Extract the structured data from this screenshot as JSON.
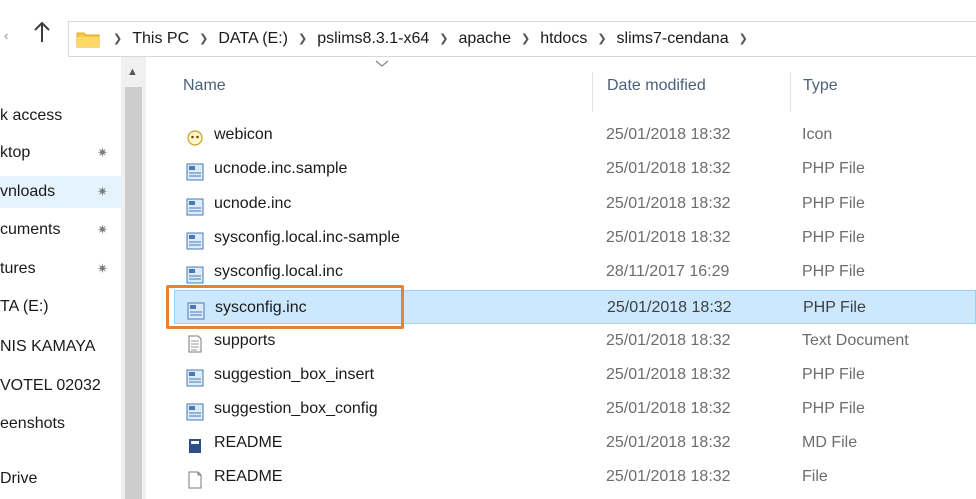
{
  "address_bar": {
    "crumbs": [
      "This PC",
      "DATA (E:)",
      "pslims8.3.1-x64",
      "apache",
      "htdocs",
      "slims7-cendana"
    ]
  },
  "nav_pane": {
    "items": [
      {
        "label": "k access",
        "pinned": false
      },
      {
        "label": "ktop",
        "pinned": true
      },
      {
        "label": "vnloads",
        "pinned": true
      },
      {
        "label": "cuments",
        "pinned": true
      },
      {
        "label": "tures",
        "pinned": true
      },
      {
        "label": "TA (E:)",
        "pinned": false
      },
      {
        "label": "NIS KAMAYA",
        "pinned": false
      },
      {
        "label": "VOTEL 02032",
        "pinned": false
      },
      {
        "label": "eenshots",
        "pinned": false
      },
      {
        "label": "Drive",
        "pinned": false
      }
    ],
    "selected_index": 2
  },
  "file_list": {
    "columns": {
      "name": "Name",
      "date": "Date modified",
      "type": "Type"
    },
    "rows": [
      {
        "name": "webicon",
        "date": "25/01/2018 18:32",
        "type": "Icon",
        "icon": "webicon-icon"
      },
      {
        "name": "ucnode.inc.sample",
        "date": "25/01/2018 18:32",
        "type": "PHP File",
        "icon": "php-file-icon"
      },
      {
        "name": "ucnode.inc",
        "date": "25/01/2018 18:32",
        "type": "PHP File",
        "icon": "php-file-icon"
      },
      {
        "name": "sysconfig.local.inc-sample",
        "date": "25/01/2018 18:32",
        "type": "PHP File",
        "icon": "php-file-icon"
      },
      {
        "name": "sysconfig.local.inc",
        "date": "28/11/2017 16:29",
        "type": "PHP File",
        "icon": "php-file-icon"
      },
      {
        "name": "sysconfig.inc",
        "date": "25/01/2018 18:32",
        "type": "PHP File",
        "icon": "php-file-icon"
      },
      {
        "name": "supports",
        "date": "25/01/2018 18:32",
        "type": "Text Document",
        "icon": "text-document-icon"
      },
      {
        "name": "suggestion_box_insert",
        "date": "25/01/2018 18:32",
        "type": "PHP File",
        "icon": "php-file-icon"
      },
      {
        "name": "suggestion_box_config",
        "date": "25/01/2018 18:32",
        "type": "PHP File",
        "icon": "php-file-icon"
      },
      {
        "name": "README",
        "date": "25/01/2018 18:32",
        "type": "MD File",
        "icon": "md-file-icon"
      },
      {
        "name": "README",
        "date": "25/01/2018 18:32",
        "type": "File",
        "icon": "blank-file-icon"
      }
    ],
    "selected_index": 5
  },
  "colors": {
    "selection": "#cce8ff",
    "highlight_box": "#e8822f",
    "header_text": "#4c607a"
  }
}
